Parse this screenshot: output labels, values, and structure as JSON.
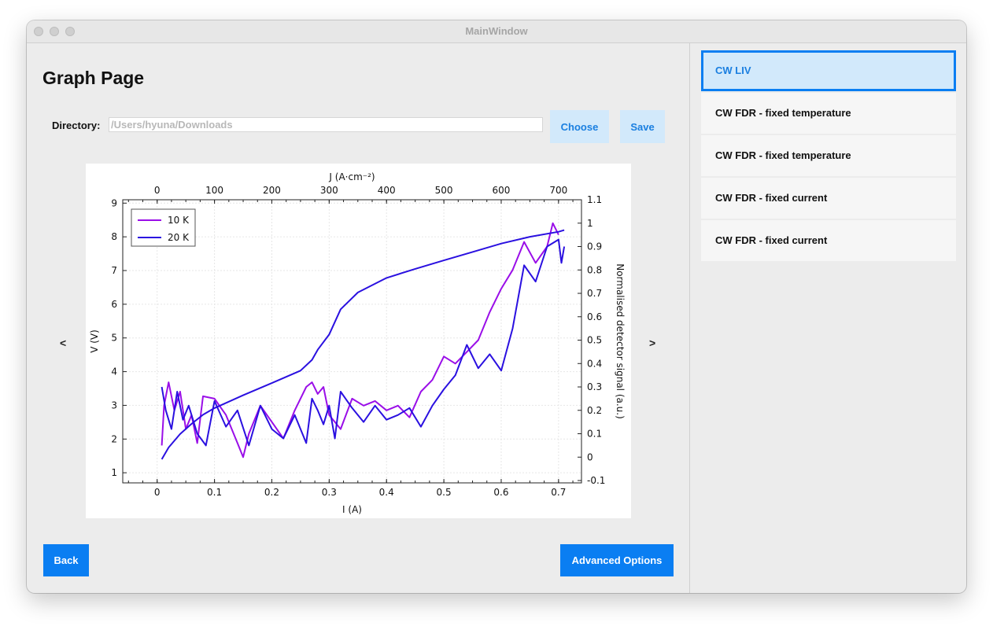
{
  "window": {
    "title": "MainWindow"
  },
  "page": {
    "title": "Graph Page"
  },
  "directory": {
    "label": "Directory:",
    "placeholder": "/Users/hyuna/Downloads"
  },
  "buttons": {
    "choose": "Choose",
    "save": "Save",
    "back": "Back",
    "advanced": "Advanced Options"
  },
  "nav": {
    "prev": "<",
    "next": ">"
  },
  "sidebar": {
    "items": [
      {
        "label": "CW LIV",
        "selected": true
      },
      {
        "label": "CW FDR - fixed temperature",
        "selected": false
      },
      {
        "label": "CW FDR - fixed temperature",
        "selected": false
      },
      {
        "label": "CW FDR - fixed current",
        "selected": false
      },
      {
        "label": "CW FDR - fixed current",
        "selected": false
      }
    ]
  },
  "colors": {
    "accent": "#0a7ef2",
    "selected_bg": "#d2e9fb",
    "series_10K": "#9a0ee8",
    "series_20K": "#2a10e0",
    "iv_curve": "#2a10e0"
  },
  "chart_data": {
    "type": "line",
    "xlabel": "I (A)",
    "ylabel": "V (V)",
    "x2label": "J (A·cm⁻²)",
    "y2label": "Normalised detector signal (a.u.)",
    "xlim": [
      -0.06,
      0.74
    ],
    "ylim": [
      0.7,
      9.1
    ],
    "x2lim": [
      -0.06,
      0.74
    ],
    "y2lim": [
      -0.11,
      1.1
    ],
    "xticks": [
      "0",
      "0.1",
      "0.2",
      "0.3",
      "0.4",
      "0.5",
      "0.6",
      "0.7"
    ],
    "yticks": [
      "1",
      "2",
      "3",
      "4",
      "5",
      "6",
      "7",
      "8",
      "9"
    ],
    "x2ticks": [
      "0",
      "100",
      "200",
      "300",
      "400",
      "500",
      "600",
      "700"
    ],
    "y2ticks": [
      "-0.1",
      "0",
      "0.1",
      "0.2",
      "0.3",
      "0.4",
      "0.5",
      "0.6",
      "0.7",
      "0.8",
      "0.9",
      "1",
      "1.1"
    ],
    "grid": true,
    "legend": {
      "position": "top-left",
      "entries": [
        "10 K",
        "20 K"
      ]
    },
    "iv_curve": {
      "axis": "left",
      "x": [
        0.008,
        0.02,
        0.04,
        0.06,
        0.08,
        0.1,
        0.15,
        0.2,
        0.25,
        0.27,
        0.28,
        0.3,
        0.32,
        0.35,
        0.4,
        0.45,
        0.5,
        0.55,
        0.6,
        0.65,
        0.7,
        0.71
      ],
      "y": [
        1.4,
        1.75,
        2.15,
        2.45,
        2.72,
        2.92,
        3.3,
        3.66,
        4.03,
        4.35,
        4.65,
        5.1,
        5.85,
        6.35,
        6.78,
        7.05,
        7.3,
        7.55,
        7.8,
        8.0,
        8.15,
        8.2
      ]
    },
    "series": [
      {
        "name": "10 K",
        "axis": "right",
        "x": [
          0.008,
          0.012,
          0.02,
          0.03,
          0.04,
          0.05,
          0.06,
          0.07,
          0.08,
          0.1,
          0.12,
          0.14,
          0.15,
          0.16,
          0.18,
          0.2,
          0.22,
          0.24,
          0.26,
          0.27,
          0.28,
          0.29,
          0.3,
          0.31,
          0.32,
          0.34,
          0.36,
          0.38,
          0.4,
          0.42,
          0.44,
          0.46,
          0.48,
          0.5,
          0.52,
          0.54,
          0.56,
          0.58,
          0.6,
          0.62,
          0.64,
          0.66,
          0.68,
          0.69,
          0.7
        ],
        "y": [
          0.05,
          0.22,
          0.32,
          0.2,
          0.28,
          0.12,
          0.18,
          0.06,
          0.26,
          0.25,
          0.18,
          0.06,
          0.0,
          0.1,
          0.22,
          0.15,
          0.08,
          0.2,
          0.3,
          0.32,
          0.27,
          0.3,
          0.18,
          0.15,
          0.12,
          0.25,
          0.22,
          0.24,
          0.2,
          0.22,
          0.17,
          0.28,
          0.33,
          0.43,
          0.4,
          0.45,
          0.5,
          0.62,
          0.72,
          0.8,
          0.92,
          0.83,
          0.9,
          1.0,
          0.95
        ]
      },
      {
        "name": "20 K",
        "axis": "right",
        "x": [
          0.008,
          0.015,
          0.025,
          0.035,
          0.045,
          0.055,
          0.07,
          0.085,
          0.1,
          0.12,
          0.14,
          0.16,
          0.18,
          0.2,
          0.22,
          0.24,
          0.26,
          0.27,
          0.28,
          0.29,
          0.3,
          0.31,
          0.32,
          0.34,
          0.36,
          0.38,
          0.4,
          0.42,
          0.44,
          0.46,
          0.48,
          0.5,
          0.52,
          0.54,
          0.56,
          0.58,
          0.6,
          0.62,
          0.64,
          0.66,
          0.68,
          0.7,
          0.705,
          0.71
        ],
        "y": [
          0.3,
          0.2,
          0.12,
          0.28,
          0.16,
          0.22,
          0.1,
          0.05,
          0.24,
          0.13,
          0.2,
          0.05,
          0.22,
          0.12,
          0.08,
          0.18,
          0.06,
          0.25,
          0.2,
          0.14,
          0.22,
          0.08,
          0.28,
          0.21,
          0.15,
          0.22,
          0.16,
          0.18,
          0.21,
          0.13,
          0.22,
          0.29,
          0.35,
          0.48,
          0.38,
          0.44,
          0.37,
          0.55,
          0.82,
          0.75,
          0.9,
          0.93,
          0.83,
          0.9
        ]
      }
    ]
  }
}
